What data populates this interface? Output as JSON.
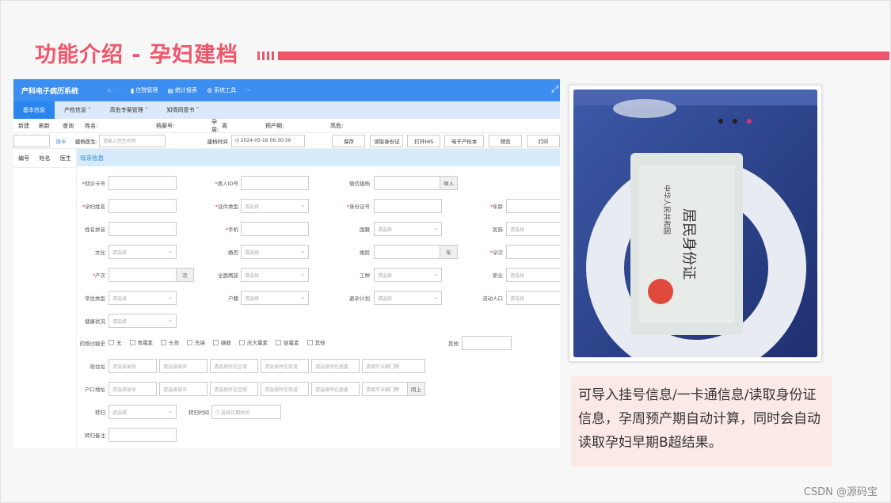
{
  "slide": {
    "title": "功能介绍 - 孕妇建档",
    "description": "可导入挂号信息/一卡通信息/读取身份证信息，孕周预产期自动计算，同时会自动读取孕妇早期B超结果。",
    "watermark": "CSDN @源码宝",
    "accent_color": "#f0566b"
  },
  "app": {
    "name": "产科电子病历系统",
    "top_menu": [
      {
        "icon": "chart-icon",
        "label": "住院管理"
      },
      {
        "icon": "stats-icon",
        "label": "统计报表"
      },
      {
        "icon": "gear-icon",
        "label": "系统工具"
      },
      {
        "icon": "more-icon",
        "label": "···"
      }
    ],
    "tabs": [
      "基本信息",
      "产检信息 ˅",
      "高危专案管理 ˅",
      "知情同意书 ˅"
    ],
    "actions": [
      "新建",
      "刷新",
      "查询"
    ],
    "summary_labels": [
      "姓名:",
      "档案号:",
      "孕周:",
      "周",
      "预产期:",
      "高危:"
    ],
    "read_card_button": "读卡",
    "record_doctor_label": "建档医生:",
    "record_doctor_placeholder": "请输入医生名称",
    "record_time_label": "建档时间",
    "record_time_value": "2024-05-16 06:50:56",
    "toolbar_buttons": [
      "保存",
      "读取身份证",
      "打开HIS",
      "电子产检本",
      "预览",
      "打印"
    ],
    "list_headers": [
      "编号",
      "姓名",
      "医生"
    ],
    "section_title": "母亲信息",
    "select_placeholder": "请选择",
    "fields": {
      "card_no": "就诊卡号",
      "patient_id": "病人ID号",
      "wechat": "微信建档",
      "import_btn": "导入",
      "name": "孕妇姓名",
      "id_type": "证件类型",
      "id_no": "身份证号",
      "age": "年龄",
      "pinyin": "姓名拼音",
      "phone": "手机",
      "nationality": "国籍",
      "ethnicity": "民族",
      "education": "文化",
      "marriage": "婚否",
      "marriage_age": "婚龄",
      "year_unit": "年",
      "gravida": "孕次",
      "parity": "产次",
      "times_unit": "次",
      "second_child": "全面两孩",
      "job_type": "工种",
      "occupation": "职业",
      "residence_type": "常住类型",
      "hukou": "户籍",
      "contraception": "避孕计划",
      "migrant": "流动人口",
      "health": "健康状况",
      "allergy": "药物过敏史",
      "allergy_options": [
        "无",
        "青霉素",
        "头孢",
        "先锋",
        "磺胺",
        "庆大霉素",
        "链霉素",
        "其他"
      ],
      "other": "其他",
      "address": "现住址",
      "hukou_address": "户口地址",
      "address_placeholders": [
        "请选择省份",
        "请选择城市",
        "请选择所在区域",
        "请选择所在街道",
        "请选择所在居委",
        "请填写详细门牌"
      ],
      "sync_btn": "同上",
      "transfer": "转归",
      "transfer_time": "转归时间",
      "transfer_time_placeholder": "选择日期时间",
      "transfer_note": "转归备注"
    }
  }
}
